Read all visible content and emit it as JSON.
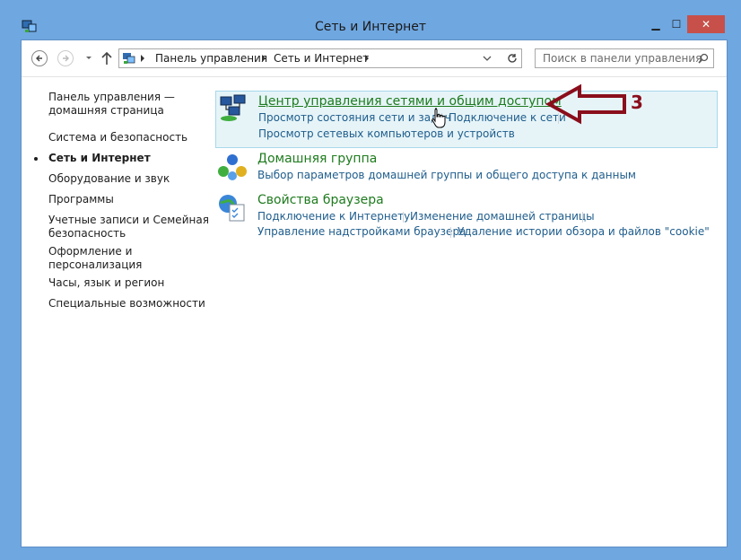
{
  "window": {
    "title": "Сеть и Интернет",
    "buttons": {
      "minimize": "▁",
      "maximize": "☐",
      "close": "✕"
    }
  },
  "navbar": {
    "back_icon": "back-arrow-icon",
    "forward_icon": "forward-arrow-icon",
    "up_icon": "up-arrow-icon",
    "breadcrumb": [
      "Панель управления",
      "Сеть и Интернет"
    ],
    "search_placeholder": "Поиск в панели управления"
  },
  "sidebar": {
    "items": [
      {
        "label": "Панель управления — домашняя страница",
        "lines": [
          "Панель управления —",
          "домашняя страница"
        ]
      },
      {
        "label": "Система и безопасность"
      },
      {
        "label": "Сеть и Интернет",
        "current": true
      },
      {
        "label": "Оборудование и звук"
      },
      {
        "label": "Программы"
      },
      {
        "label": "Учетные записи и Семейная безопасность",
        "lines": [
          "Учетные записи и Семейная",
          "безопасность"
        ]
      },
      {
        "label": "Оформление и персонализация",
        "lines": [
          "Оформление и",
          "персонализация"
        ]
      },
      {
        "label": "Часы, язык и регион"
      },
      {
        "label": "Специальные возможности"
      }
    ]
  },
  "categories": [
    {
      "title": "Центр управления сетями и общим доступом",
      "icon": "network-center-icon",
      "highlighted": true,
      "links": [
        "Просмотр состояния сети и задач",
        "Подключение к сети",
        "Просмотр сетевых компьютеров и устройств"
      ]
    },
    {
      "title": "Домашняя группа",
      "icon": "homegroup-icon",
      "links": [
        "Выбор параметров домашней группы и общего доступа к данным"
      ]
    },
    {
      "title": "Свойства браузера",
      "icon": "browser-properties-icon",
      "links": [
        "Подключение к Интернету",
        "Изменение домашней страницы",
        "Управление надстройками браузера",
        "Удаление истории обзора и файлов \"cookie\""
      ]
    }
  ],
  "annotation": {
    "number": "3",
    "color": "#8a0e1c"
  },
  "colors": {
    "titlebar": "#6fa7e0",
    "close": "#c7504a",
    "category_title": "#1e7b1e",
    "link": "#1f5d8c",
    "highlight": "#e6f4f8"
  }
}
